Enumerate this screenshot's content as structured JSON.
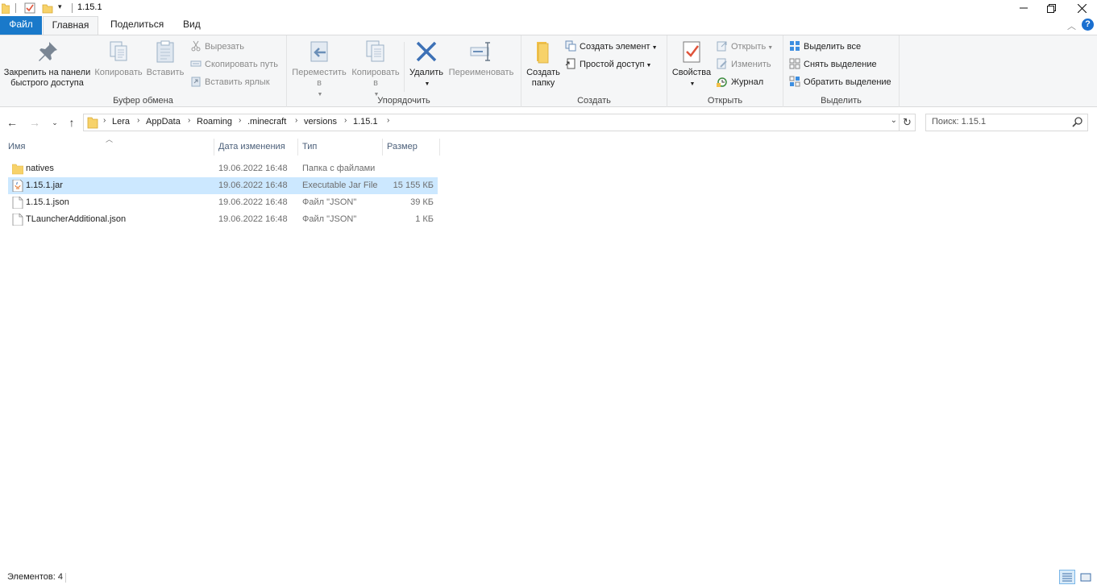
{
  "window": {
    "title": "1.15.1",
    "controls": [
      "minimize",
      "maximize",
      "close"
    ]
  },
  "tabs": [
    {
      "label": "Файл"
    },
    {
      "label": "Главная"
    },
    {
      "label": "Поделиться"
    },
    {
      "label": "Вид"
    }
  ],
  "ribbon": {
    "clipboard": {
      "label": "Буфер обмена",
      "pin": "Закрепить на панели быстрого доступа",
      "copy": "Копировать",
      "paste": "Вставить",
      "cut": "Вырезать",
      "copy_path": "Скопировать путь",
      "paste_shortcut": "Вставить ярлык"
    },
    "organize": {
      "label": "Упорядочить",
      "move_to": "Переместить в",
      "copy_to": "Копировать в",
      "delete": "Удалить",
      "rename": "Переименовать"
    },
    "new": {
      "label": "Создать",
      "new_folder": "Создать папку",
      "new_item": "Создать элемент",
      "easy_access": "Простой доступ"
    },
    "open": {
      "label": "Открыть",
      "properties": "Свойства",
      "open": "Открыть",
      "edit": "Изменить",
      "history": "Журнал"
    },
    "select": {
      "label": "Выделить",
      "select_all": "Выделить все",
      "select_none": "Снять выделение",
      "invert": "Обратить выделение"
    }
  },
  "address": {
    "crumbs": [
      "Lera",
      "AppData",
      "Roaming",
      ".minecraft",
      "versions",
      "1.15.1"
    ]
  },
  "search": {
    "placeholder": "Поиск: 1.15.1"
  },
  "columns": {
    "name": "Имя",
    "date": "Дата изменения",
    "type": "Тип",
    "size": "Размер"
  },
  "files": [
    {
      "name": "natives",
      "date": "19.06.2022 16:48",
      "type": "Папка с файлами",
      "size": "",
      "icon": "folder-icon"
    },
    {
      "name": "1.15.1.jar",
      "date": "19.06.2022 16:48",
      "type": "Executable Jar File",
      "size": "15 155 КБ",
      "icon": "jar-file-icon"
    },
    {
      "name": "1.15.1.json",
      "date": "19.06.2022 16:48",
      "type": "Файл \"JSON\"",
      "size": "39 КБ",
      "icon": "document-icon"
    },
    {
      "name": "TLauncherAdditional.json",
      "date": "19.06.2022 16:48",
      "type": "Файл \"JSON\"",
      "size": "1 КБ",
      "icon": "document-icon"
    }
  ],
  "status": {
    "count": "Элементов: 4"
  },
  "colors": {
    "accent": "#1979ca",
    "selection": "#cce8ff",
    "ribbon_bg": "#f5f6f7"
  }
}
